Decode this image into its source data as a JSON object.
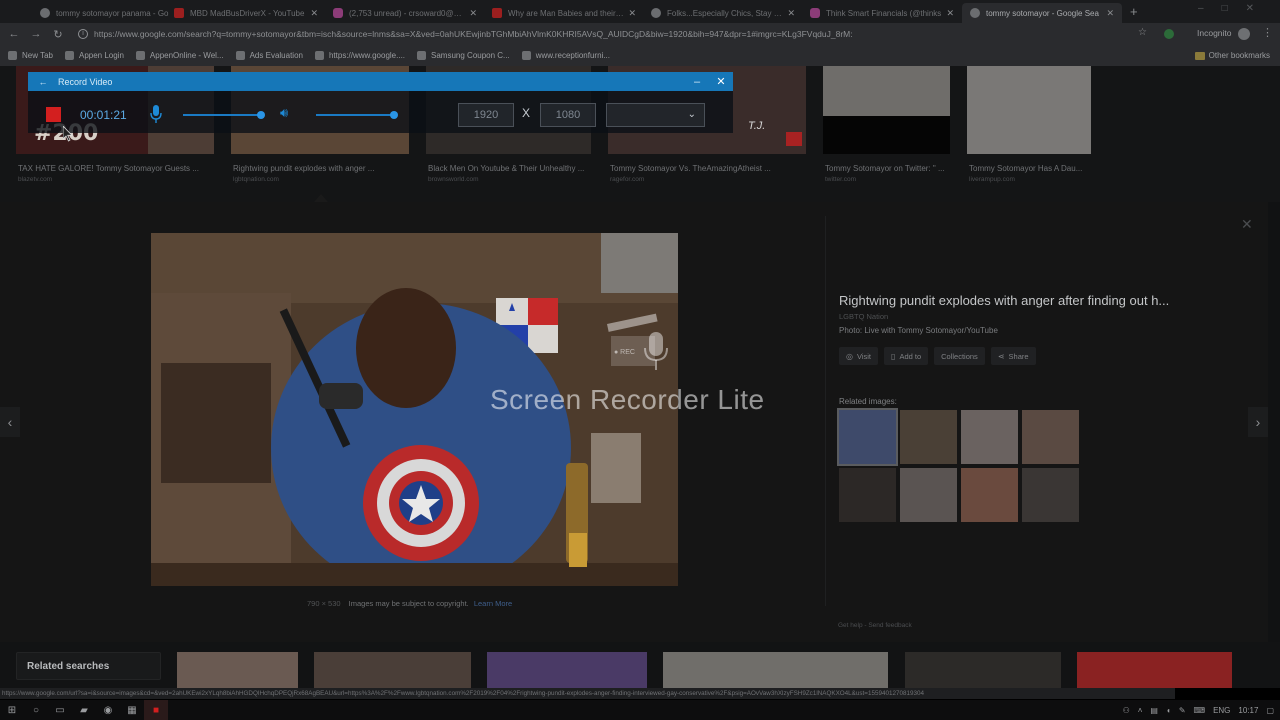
{
  "browser": {
    "tabs": [
      {
        "title": "tommy sotomayor panama - Go",
        "favicon": "google",
        "active": false
      },
      {
        "title": "MBD MadBusDriverX - YouTube",
        "favicon": "youtube",
        "active": false
      },
      {
        "title": "(2,753 unread) - crsoward0@yah",
        "favicon": "yahoo",
        "active": false
      },
      {
        "title": "Why are Man Babies and their M",
        "favicon": "youtube",
        "active": false
      },
      {
        "title": "Folks...Especially Chics, Stay In Yo",
        "favicon": "generic",
        "active": false
      },
      {
        "title": "Think Smart Financials (@thinks",
        "favicon": "instagram",
        "active": false
      },
      {
        "title": "tommy sotomayor - Google Sea",
        "favicon": "google",
        "active": true
      }
    ],
    "url": "https://www.google.com/search?q=tommy+sotomayor&tbm=isch&source=lnms&sa=X&ved=0ahUKEwjinbTGhMbiAhVlmK0KHRI5AVsQ_AUIDCgD&biw=1920&bih=947&dpr=1#imgrc=KLg3FVqduJ_8rM:",
    "profile": "Incognito",
    "bookmarks": [
      "New Tab",
      "Appen Login",
      "AppenOnline - Wel...",
      "Ads Evaluation",
      "https://www.google....",
      "Samsung Coupon C...",
      "www.receptionfurni..."
    ],
    "other_bookmarks": "Other bookmarks"
  },
  "results_row": [
    {
      "caption": "TAX HATE GALORE! Tommy Sotomayor Guests ...",
      "source": "blazetv.com"
    },
    {
      "caption": "Rightwing pundit explodes with anger ...",
      "source": "lgbtqnation.com"
    },
    {
      "caption": "Black Men On Youtube & Their Unhealthy ...",
      "source": "brownsworld.com"
    },
    {
      "caption": "Tommy Sotomayor Vs. TheAmazingAtheist ...",
      "source": "ragefor.com"
    },
    {
      "caption": "Tommy Sotomayor on Twitter: \" ...",
      "source": "twitter.com"
    },
    {
      "caption": "Tommy Sotomayor Has A Dau...",
      "source": "liverampup.com"
    }
  ],
  "viewer": {
    "title": "Rightwing pundit explodes with anger after finding out h...",
    "source": "LGBTQ Nation",
    "photo_credit": "Photo: Live with Tommy Sotomayor/YouTube",
    "actions": [
      "Visit",
      "Add to",
      "Collections",
      "Share"
    ],
    "related_label": "Related images:",
    "dimensions": "790 × 530",
    "copyright": "Images may be subject to copyright.",
    "learn_more": "Learn More",
    "footer": "Get help  -  Send feedback"
  },
  "related_searches_label": "Related searches",
  "status_url": "https://www.google.com/url?sa=i&source=images&cd=&ved=2ahUKEwi2xYLqh8biAhHGDQIHchqDPEQjRx68AgBEAU&url=https%3A%2F%2Fwww.lgbtqnation.com%2F2019%2F04%2Frightwing-pundit-explodes-anger-finding-interviewed-gay-conservative%2F&psig=AOvVaw3hXlzyFSH9Zc1lNAQKXO4L&ust=1559401270819304",
  "recorder": {
    "title": "Record Video",
    "timer": "00:01:21",
    "width": "1920",
    "height": "1080",
    "separator": "X",
    "dropdown_value": ""
  },
  "watermark": {
    "text": "Screen Recorder Lite",
    "rec": "● REC"
  },
  "taskbar": {
    "language": "ENG",
    "time": "10:17"
  },
  "colors": {
    "recorder_titlebar": "#1677b8",
    "stop_red": "#d31f1f",
    "accent_blue": "#1e8ad6"
  }
}
